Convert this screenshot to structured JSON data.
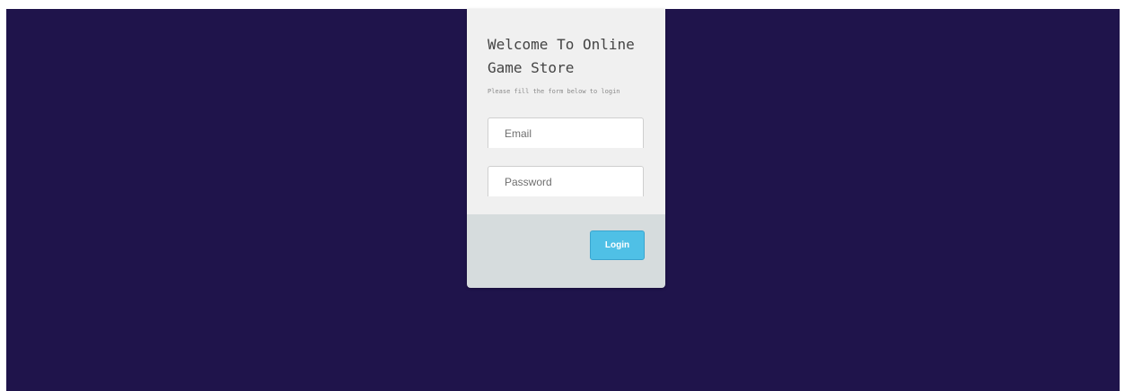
{
  "login_card": {
    "title": "Welcome To Online Game Store",
    "subtitle": "Please fill the form below to login",
    "email_placeholder": "Email",
    "email_value": "",
    "password_placeholder": "Password",
    "password_value": "",
    "login_label": "Login"
  },
  "colors": {
    "page_background": "#1f144b",
    "card_body": "#f0f0f0",
    "card_footer": "#d6dcdd",
    "login_button": "#4fc0e6"
  }
}
